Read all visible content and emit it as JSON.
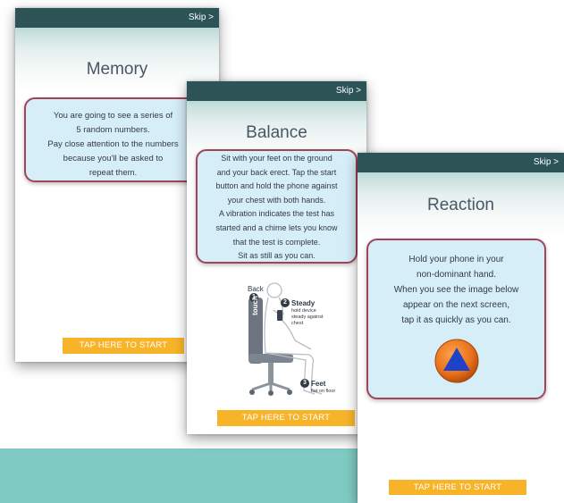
{
  "memory": {
    "skip_label": "Skip >",
    "title": "Memory",
    "instructions": [
      "You are going to see a series of",
      "5 random numbers.",
      "Pay close attention to the numbers",
      "because you'll be asked to",
      "repeat them."
    ],
    "start_label": "TAP HERE TO START"
  },
  "balance": {
    "skip_label": "Skip >",
    "title": "Balance",
    "instructions": [
      "Sit with your feet on the ground",
      "and your back erect. Tap the start",
      "button and hold the phone against",
      "your chest with both hands.",
      "A vibration indicates the test has",
      "started and a chime lets you know",
      "that the test is complete.",
      "Sit as still as you can."
    ],
    "illustration": {
      "back_label": "Back",
      "back_number": "1",
      "chair_label": "don't touch",
      "steady_number": "2",
      "steady_label": "Steady",
      "steady_sub": [
        "hold device",
        "steady against",
        "chest"
      ],
      "feet_number": "3",
      "feet_label": "Feet",
      "feet_sub": "flat on floor"
    },
    "start_label": "TAP HERE TO START"
  },
  "reaction": {
    "skip_label": "Skip >",
    "title": "Reaction",
    "instructions": [
      "Hold your phone in your",
      "non-dominant hand.",
      "When you see the image below",
      "appear on the next screen,",
      "tap it as quickly as you can."
    ],
    "target_icon": "blue-triangle-in-orange-circle",
    "start_label": "TAP HERE TO START"
  },
  "colors": {
    "topbar": "#2c5457",
    "box_fill": "#d6eef7",
    "box_border": "#a04457",
    "start_button": "#f8b429",
    "teal_band": "#7fcbc3",
    "target_circle": "#e8711c",
    "target_triangle": "#1f43c8"
  }
}
